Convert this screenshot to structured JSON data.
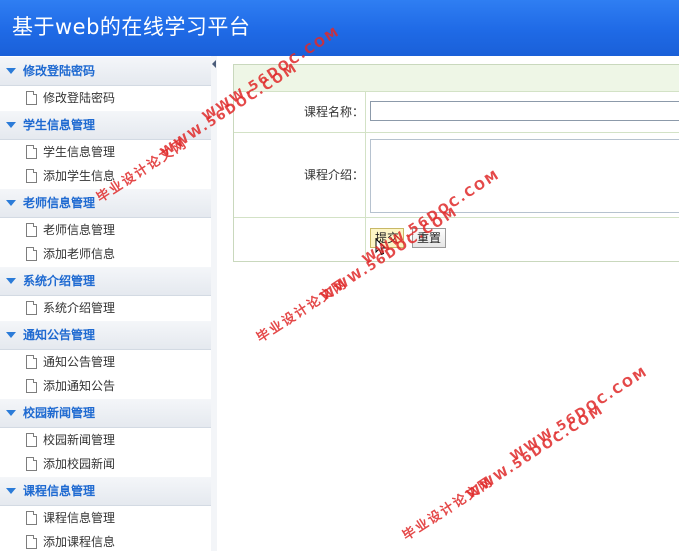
{
  "header": {
    "title": "基于web的在线学习平台"
  },
  "sidebar": {
    "groups": [
      {
        "title": "修改登陆密码",
        "items": [
          "修改登陆密码"
        ]
      },
      {
        "title": "学生信息管理",
        "items": [
          "学生信息管理",
          "添加学生信息"
        ]
      },
      {
        "title": "老师信息管理",
        "items": [
          "老师信息管理",
          "添加老师信息"
        ]
      },
      {
        "title": "系统介绍管理",
        "items": [
          "系统介绍管理"
        ]
      },
      {
        "title": "通知公告管理",
        "items": [
          "通知公告管理",
          "添加通知公告"
        ]
      },
      {
        "title": "校园新闻管理",
        "items": [
          "校园新闻管理",
          "添加校园新闻"
        ]
      },
      {
        "title": "课程信息管理",
        "items": [
          "课程信息管理",
          "添加课程信息"
        ]
      }
    ]
  },
  "form": {
    "course_name_label": "课程名称：",
    "course_name_value": "",
    "course_intro_label": "课程介绍：",
    "course_intro_value": "",
    "submit_label": "提交",
    "reset_label": "重置"
  },
  "watermark": {
    "site": "WWW.56DOC.COM",
    "slogan": "毕业设计论文网",
    "color": "#e02a2a"
  },
  "colors": {
    "header_blue": "#1f6ae6",
    "sidebar_group_text": "#1f6ad1",
    "form_band": "#eef6e6"
  }
}
